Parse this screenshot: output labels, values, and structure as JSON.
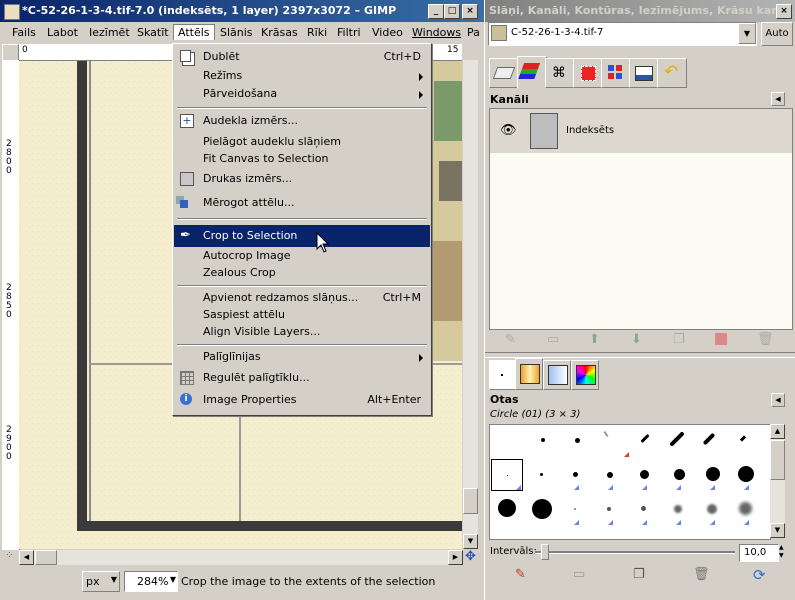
{
  "gimp_window": {
    "title": "*C-52-26-1-3-4.tif-7.0 (indeksēts, 1 layer) 2397x3072 – GIMP",
    "menubar": [
      "Fails",
      "Labot",
      "Iezīmēt",
      "Skatīt",
      "Attēls",
      "Slānis",
      "Krāsas",
      "Rīki",
      "Filtri",
      "Video",
      "Windows",
      "Pa"
    ],
    "ruler_h_labels": [
      "0",
      "15"
    ],
    "ruler_v_labels": [
      "2800",
      "2850",
      "2900"
    ],
    "unit": "px",
    "zoom": "284%",
    "status_text": "Crop the image to the extents of the selection"
  },
  "attels_menu": {
    "items": [
      {
        "label": "Dublēt",
        "accel": "Ctrl+D",
        "icon": "duplicate-icon"
      },
      {
        "label": "Režīms",
        "submenu": true
      },
      {
        "label": "Pārveidošana",
        "submenu": true
      },
      {
        "label": "Audekla izmērs...",
        "icon": "canvas-size-icon"
      },
      {
        "label": "Pielāgot audeklu slāņiem"
      },
      {
        "label": "Fit Canvas to Selection"
      },
      {
        "label": "Drukas izmērs...",
        "icon": "print-size-icon"
      },
      {
        "label": "Mērogot attēlu...",
        "icon": "scale-icon"
      },
      {
        "label": "Crop to Selection",
        "icon": "crop-icon",
        "highlighted": true
      },
      {
        "label": "Autocrop Image"
      },
      {
        "label": "Zealous Crop"
      },
      {
        "label": "Apvienot redzamos slāņus...",
        "accel": "Ctrl+M"
      },
      {
        "label": "Saspiest attēlu"
      },
      {
        "label": "Align Visible Layers..."
      },
      {
        "label": "Palīglīnijas",
        "submenu": true
      },
      {
        "label": "Regulēt palīgtīklu...",
        "icon": "grid-icon"
      },
      {
        "label": "Image Properties",
        "accel": "Alt+Enter",
        "icon": "info-icon"
      }
    ]
  },
  "dock_window": {
    "title": "Slāņi, Kanāli, Kontūras, Iezīmējums, Krāsu karte, ...",
    "image_selector": "C-52-26-1-3-4.tif-7",
    "auto_button": "Auto",
    "channels_title": "Kanāli",
    "channel_name": "Indeksēts",
    "brushes_title": "Otas",
    "brush_name": "Circle (01) (3 × 3)",
    "spacing_label": "Intervāls:",
    "spacing_value": "10,0",
    "spacing": 0.1
  }
}
